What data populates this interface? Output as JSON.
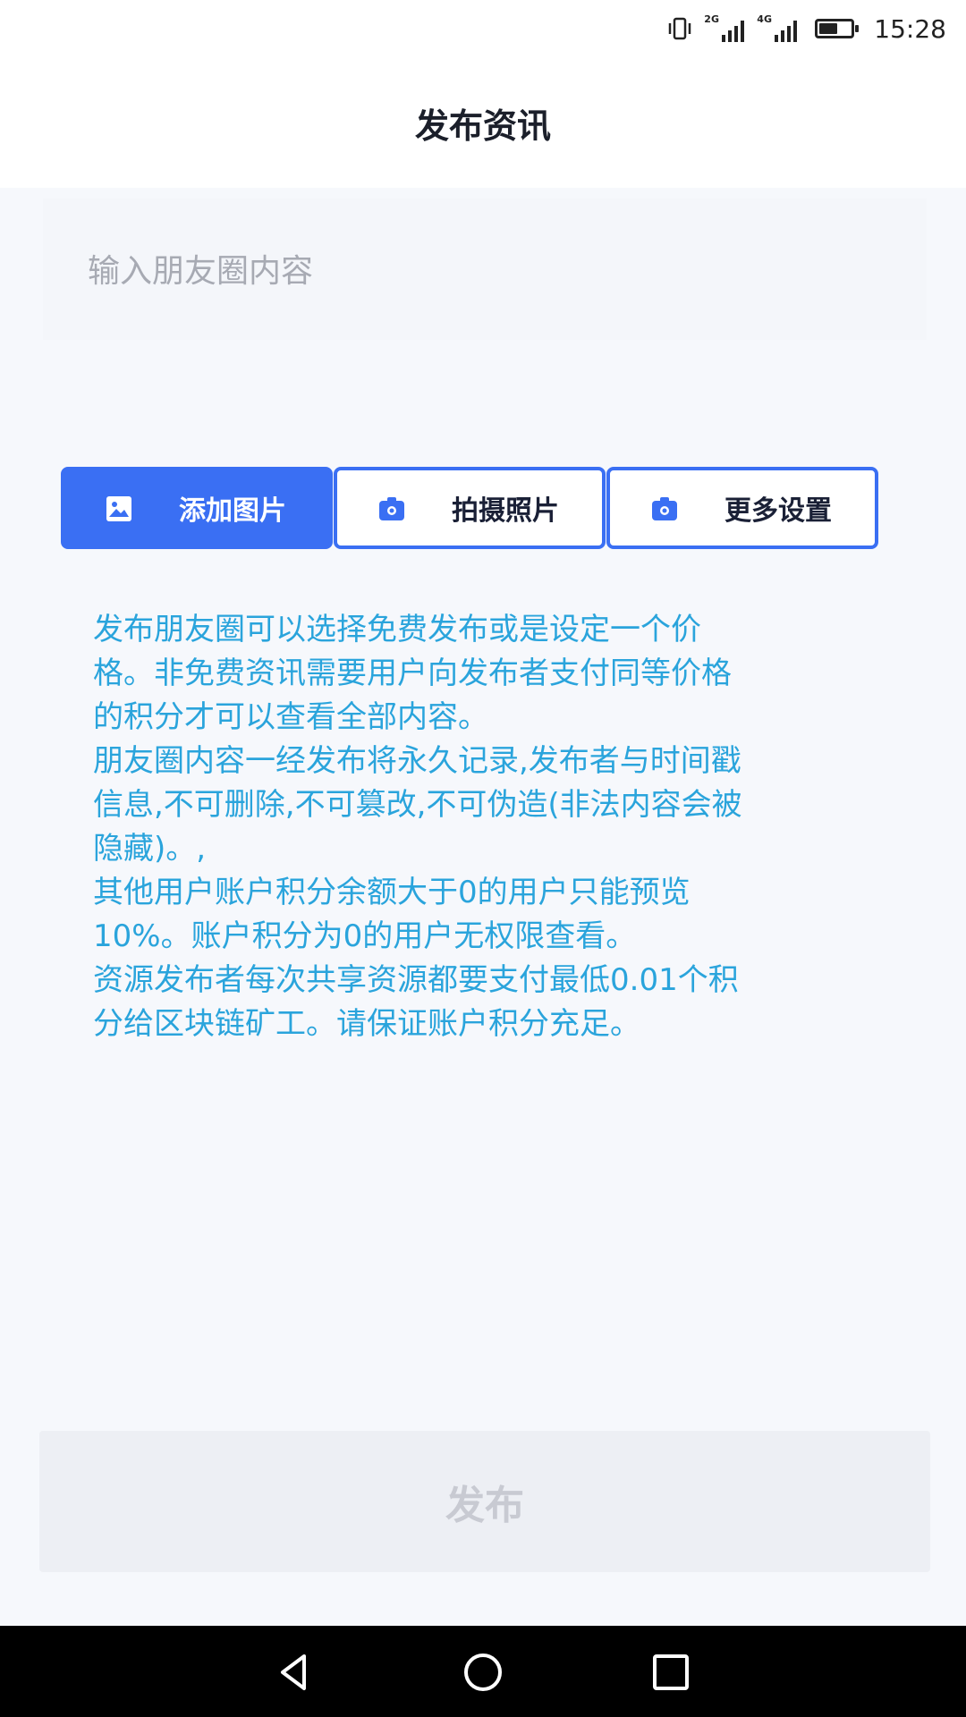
{
  "status_bar": {
    "network_1": "2G",
    "network_2": "4G",
    "battery_level": 0.6,
    "time": "15:28"
  },
  "header": {
    "title": "发布资讯"
  },
  "content_input": {
    "placeholder": "输入朋友圈内容"
  },
  "actions": [
    {
      "label": "添加图片",
      "icon": "image-icon"
    },
    {
      "label": "拍摄照片",
      "icon": "camera-icon"
    },
    {
      "label": "更多设置",
      "icon": "camera-icon"
    }
  ],
  "info": {
    "lines": [
      "发布朋友圈可以选择免费发布或是设定一个价",
      "格。非免费资讯需要用户向发布者支付同等价格",
      "的积分才可以查看全部内容。",
      "朋友圈内容一经发布将永久记录,发布者与时间戳",
      "信息,不可删除,不可篡改,不可伪造(非法内容会被",
      "隐藏)。,",
      "其他用户账户积分余额大于0的用户只能预览",
      "10%。账户积分为0的用户无权限查看。",
      "资源发布者每次共享资源都要支付最低0.01个积",
      "分给区块链矿工。请保证账户积分充足。"
    ]
  },
  "publish_button": {
    "label": "发布"
  },
  "nav_bar": {
    "items": [
      "back-icon",
      "home-icon",
      "recents-icon"
    ]
  },
  "colors": {
    "accent": "#3a6ff3",
    "info_text": "#2aa4dc"
  }
}
